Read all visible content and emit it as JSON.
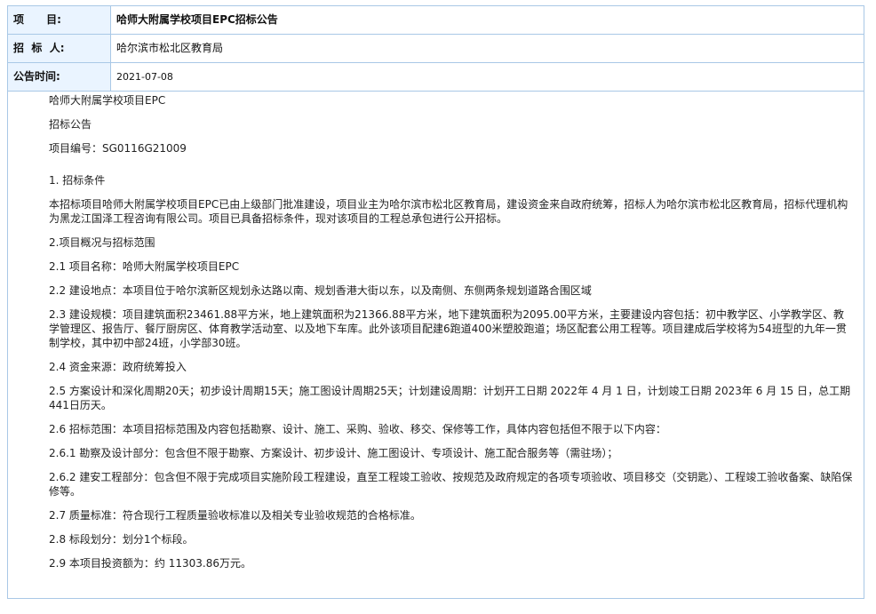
{
  "header": {
    "project_label": "项      目:",
    "project_value": "哈师大附属学校项目EPC招标公告",
    "tenderer_label": "招  标  人:",
    "tenderer_value": "哈尔滨市松北区教育局",
    "date_label": "公告时间:",
    "date_value": "2021-07-08"
  },
  "body": {
    "paragraphs": [
      "哈师大附属学校项目EPC",
      "招标公告",
      "项目编号：SG0116G21009",
      "1. 招标条件",
      "本招标项目哈师大附属学校项目EPC已由上级部门批准建设，项目业主为哈尔滨市松北区教育局，建设资金来自政府统筹，招标人为哈尔滨市松北区教育局，招标代理机构为黑龙江国泽工程咨询有限公司。项目已具备招标条件，现对该项目的工程总承包进行公开招标。",
      "2.项目概况与招标范围",
      "2.1 项目名称：哈师大附属学校项目EPC",
      "2.2 建设地点：本项目位于哈尔滨新区规划永达路以南、规划香港大街以东，以及南侧、东侧两条规划道路合围区域",
      "2.3 建设规模：项目建筑面积23461.88平方米，地上建筑面积为21366.88平方米，地下建筑面积为2095.00平方米，主要建设内容包括：初中教学区、小学教学区、教学管理区、报告厅、餐厅厨房区、体育教学活动室、以及地下车库。此外该项目配建6跑道400米塑胶跑道；场区配套公用工程等。项目建成后学校将为54班型的九年一贯制学校，其中初中部24班，小学部30班。",
      "2.4 资金来源：政府统筹投入",
      "2.5 方案设计和深化周期20天；初步设计周期15天；施工图设计周期25天；计划建设周期：计划开工日期 2022年 4 月 1 日，计划竣工日期 2023年 6 月 15 日，总工期441日历天。",
      "2.6 招标范围：本项目招标范围及内容包括勘察、设计、施工、采购、验收、移交、保修等工作，具体内容包括但不限于以下内容：",
      "2.6.1 勘察及设计部分：包含但不限于勘察、方案设计、初步设计、施工图设计、专项设计、施工配合服务等（需驻场）；",
      "2.6.2 建安工程部分：包含但不限于完成项目实施阶段工程建设，直至工程竣工验收、按规范及政府规定的各项专项验收、项目移交（交钥匙）、工程竣工验收备案、缺陷保修等。",
      "2.7 质量标准：符合现行工程质量验收标准以及相关专业验收规范的合格标准。",
      "2.8 标段划分：划分1个标段。",
      "2.9 本项目投资额为：约 11303.86万元。"
    ]
  }
}
